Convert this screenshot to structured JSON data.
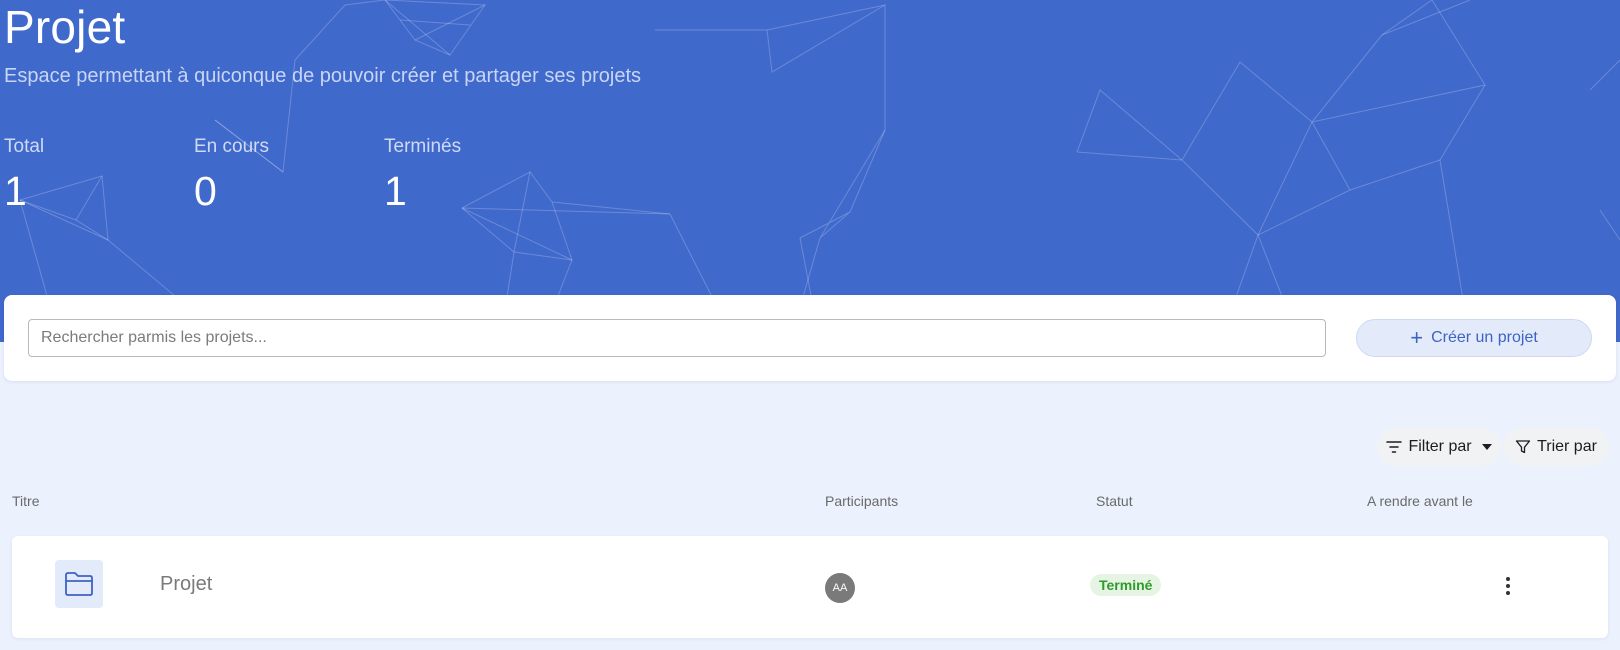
{
  "hero": {
    "title": "Projet",
    "subtitle": "Espace permettant à quiconque de pouvoir créer et partager ses projets",
    "background_color": "#4069cc",
    "stats": [
      {
        "label": "Total",
        "value": "1"
      },
      {
        "label": "En cours",
        "value": "0"
      },
      {
        "label": "Terminés",
        "value": "1"
      }
    ]
  },
  "search": {
    "placeholder": "Rechercher parmis les projets...",
    "value": ""
  },
  "actions": {
    "create_label": "Créer un projet",
    "create_icon": "plus-icon",
    "filter_label": "Filter par",
    "filter_icon": "filter-lines-icon",
    "sort_label": "Trier par",
    "sort_icon": "funnel-icon"
  },
  "table": {
    "columns": [
      "Titre",
      "Participants",
      "Statut",
      "A rendre avant le"
    ],
    "rows": [
      {
        "icon": "folder-icon",
        "title": "Projet",
        "participants": [
          "AA"
        ],
        "status": "Terminé",
        "status_color": "#2e9b2a",
        "due_date": "",
        "menu_icon": "more-vertical-icon"
      }
    ]
  }
}
